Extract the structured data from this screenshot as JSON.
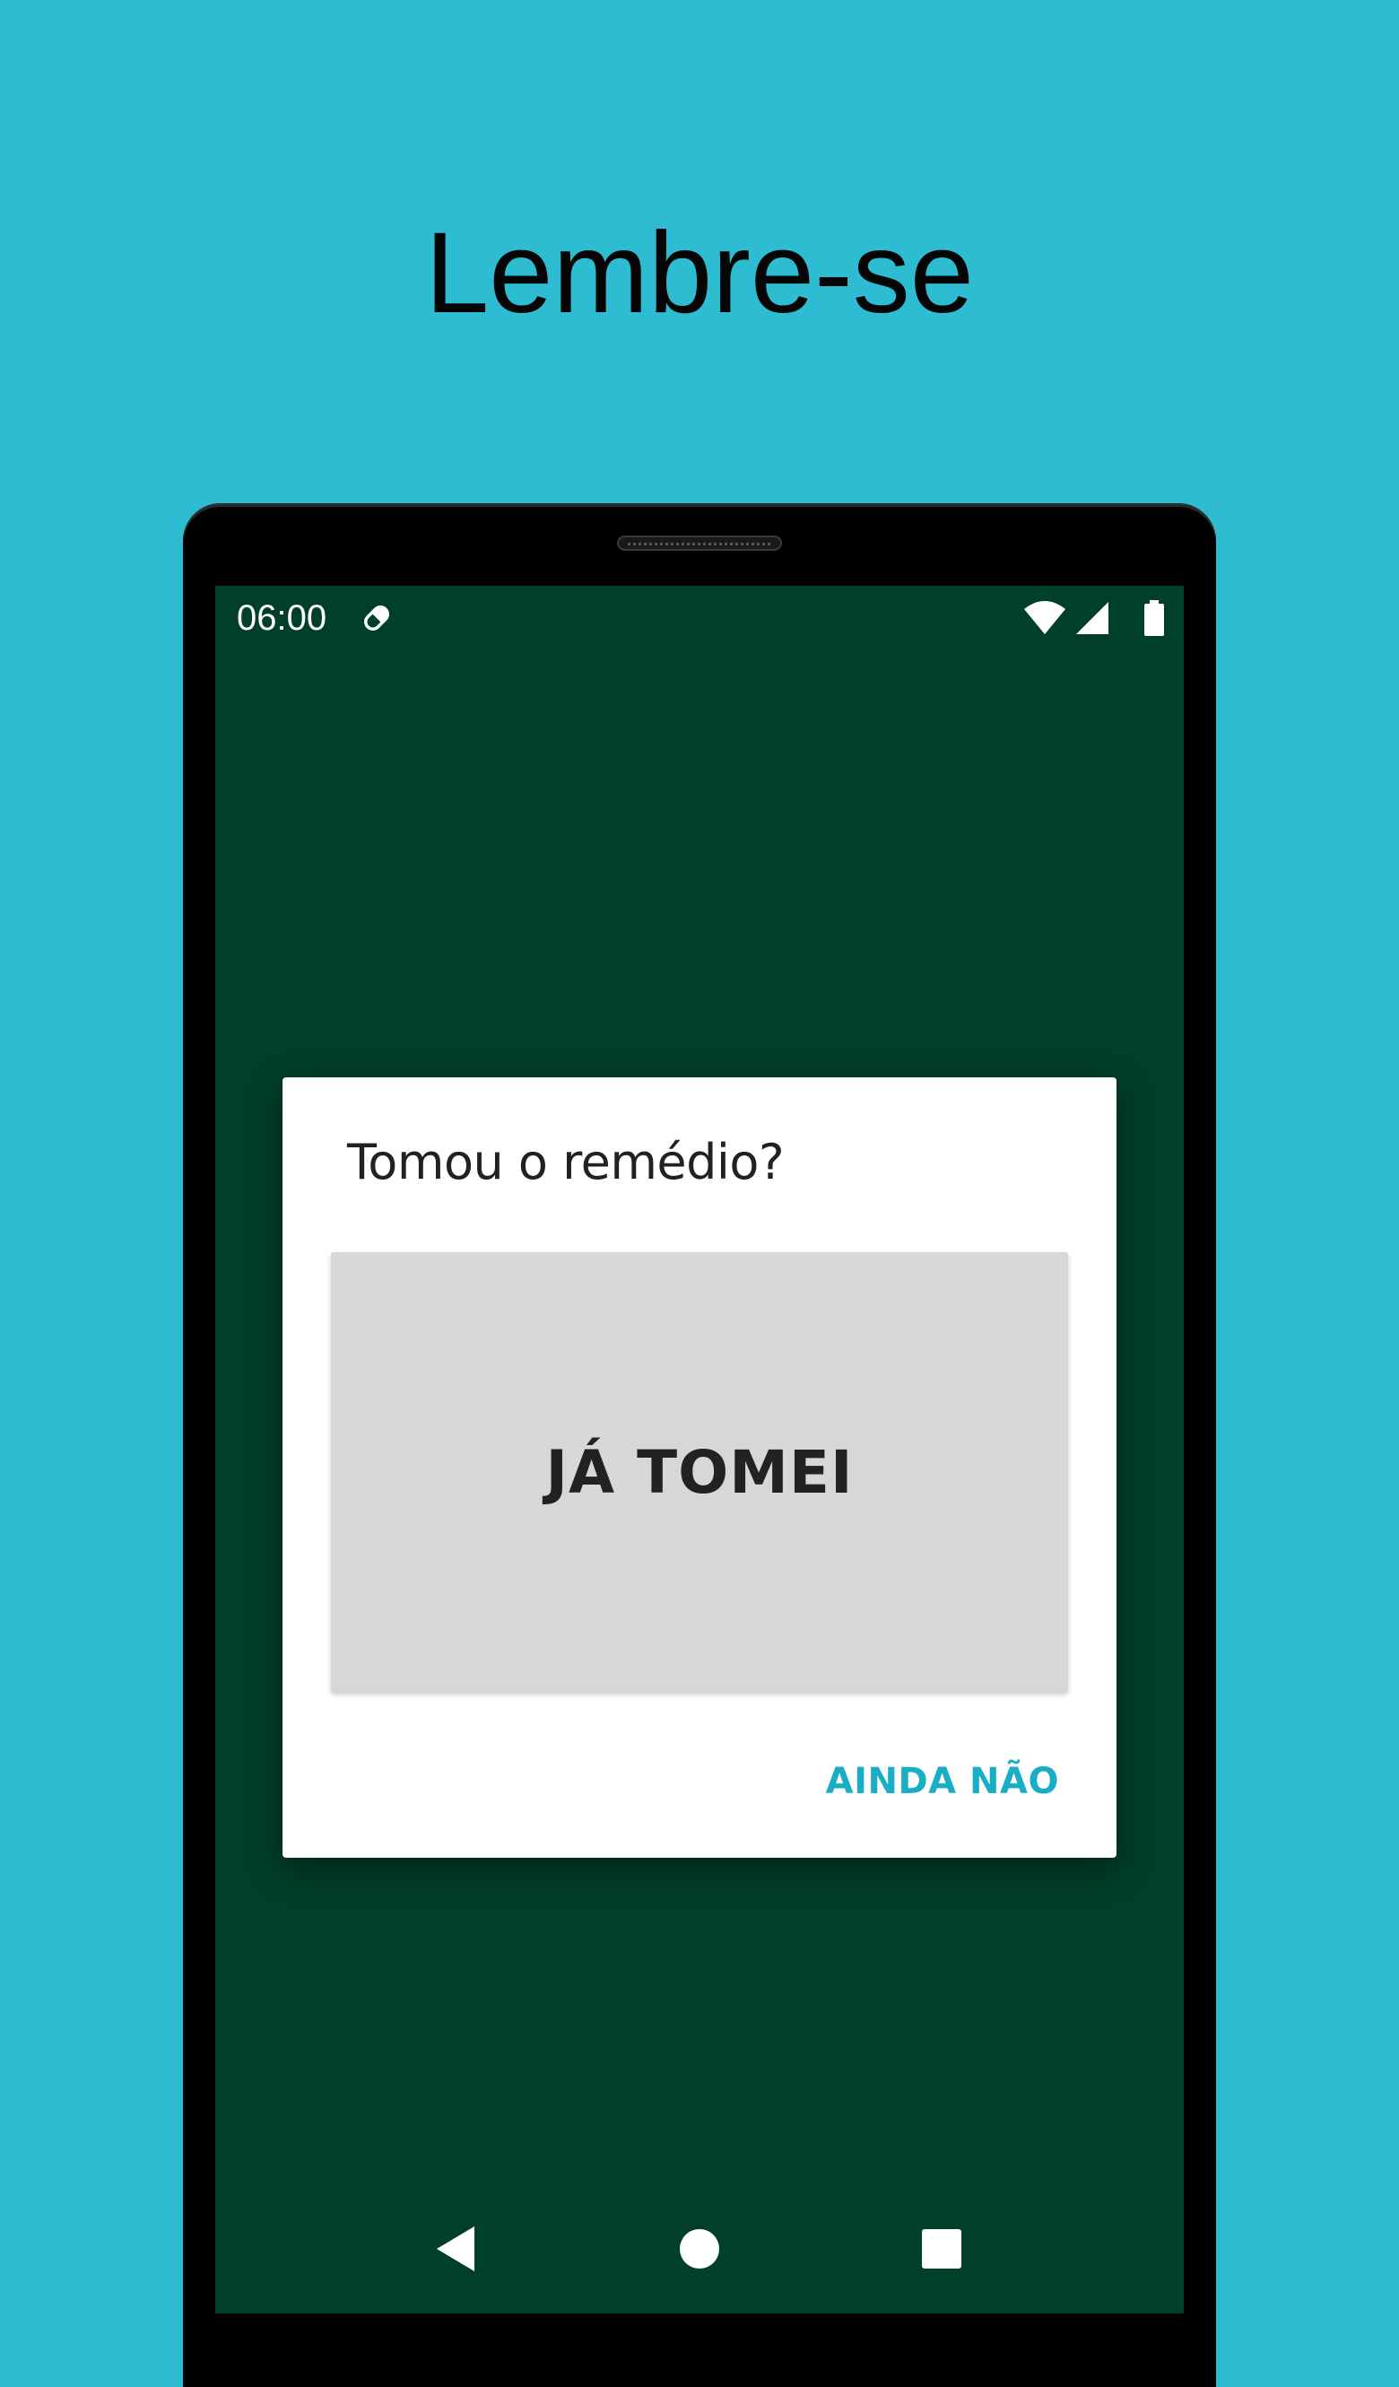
{
  "promo": {
    "headline": "Lembre-se"
  },
  "status_bar": {
    "time": "06:00",
    "notification_icon": "pill-icon",
    "icons": [
      "wifi-icon",
      "signal-icon",
      "battery-icon"
    ]
  },
  "dialog": {
    "title": "Tomou o remédio?",
    "confirm_label": "JÁ TOMEI",
    "decline_label": "AINDA NÃO"
  },
  "nav_bar": {
    "icons": [
      "back-icon",
      "home-icon",
      "recents-icon"
    ]
  },
  "colors": {
    "background": "#2ebcd3",
    "screen": "#003f28",
    "accent": "#1aaec5",
    "dialog": "#ffffff",
    "button": "#d6d7d7"
  }
}
